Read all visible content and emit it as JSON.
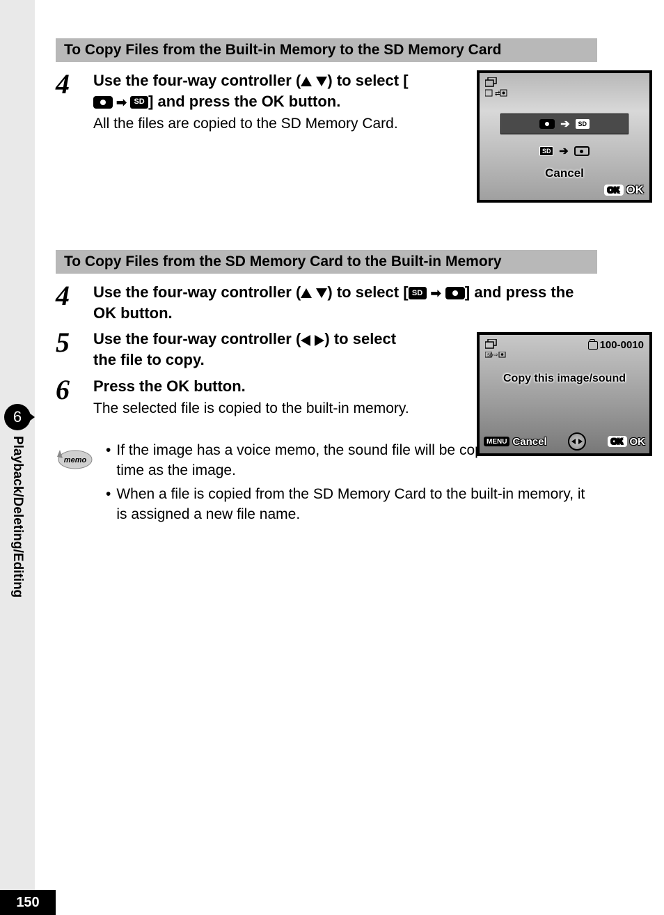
{
  "section1": {
    "header": "To Copy Files from the Built-in Memory to the SD Memory Card",
    "step4_num": "4",
    "step4_title_a": "Use the four-way controller (",
    "step4_title_b": ") to select [",
    "step4_title_c": "] and press the OK button.",
    "step4_desc": "All the files are copied to the SD Memory Card."
  },
  "screen1": {
    "sd_label": "SD",
    "cancel": "Cancel",
    "ok_badge": "OK",
    "ok_text": "OK"
  },
  "section2": {
    "header": "To Copy Files from the SD Memory Card to the Built-in Memory",
    "step4_num": "4",
    "step4_title_a": "Use the four-way controller (",
    "step4_title_b": ") to select [",
    "step4_title_c": "] and press the OK button.",
    "step5_num": "5",
    "step5_title_a": "Use the four-way controller (",
    "step5_title_b": ") to select the file to copy.",
    "step6_num": "6",
    "step6_title": "Press the OK button.",
    "step6_desc": "The selected file is copied to the built-in memory."
  },
  "screen2": {
    "file_no": "100-0010",
    "prompt": "Copy this image/sound",
    "menu_badge": "MENU",
    "cancel": "Cancel",
    "ok_badge": "OK",
    "ok_text": "OK"
  },
  "memo": {
    "label": "memo",
    "item1": "If the image has a voice memo, the sound file will be copied at the same time as the image.",
    "item2": "When a file is copied from the SD Memory Card to the built-in memory, it is assigned a new file name."
  },
  "side": {
    "chapter": "6",
    "label": "Playback/Deleting/Editing"
  },
  "footer": {
    "page": "150"
  },
  "icons": {
    "sd_text": "SD"
  }
}
